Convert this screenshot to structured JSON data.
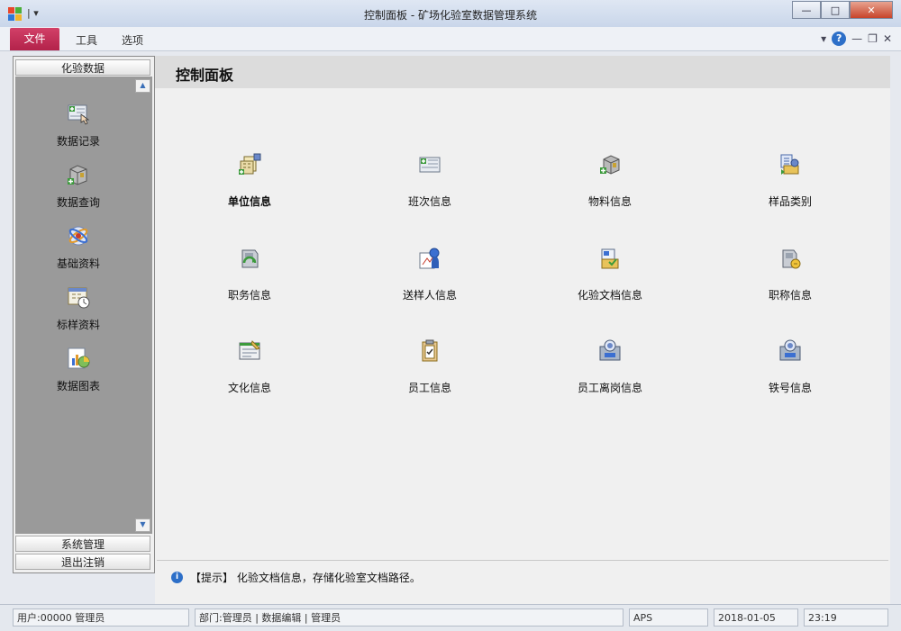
{
  "window": {
    "title": "控制面板 - 矿场化验室数据管理系统",
    "qat": "|  ▾",
    "min": "—",
    "max": "□",
    "close": "✕"
  },
  "ribbon": {
    "file": "文件",
    "tabs": [
      "工具",
      "选项"
    ],
    "help": "?",
    "chevron": "▾",
    "min": "—",
    "restore": "❐",
    "close": "✕"
  },
  "sidebar": {
    "group_top": "化验数据",
    "items": [
      {
        "label": "数据记录",
        "icon": "data-record-icon"
      },
      {
        "label": "数据查询",
        "icon": "data-query-icon"
      },
      {
        "label": "基础资料",
        "icon": "basic-info-icon"
      },
      {
        "label": "标样资料",
        "icon": "standard-sample-icon"
      },
      {
        "label": "数据图表",
        "icon": "data-chart-icon"
      }
    ],
    "group_system": "系统管理",
    "group_logout": "退出注销"
  },
  "main": {
    "title": "控制面板",
    "items": [
      {
        "label": "单位信息",
        "icon": "unit-info-icon"
      },
      {
        "label": "班次信息",
        "icon": "shift-info-icon"
      },
      {
        "label": "物料信息",
        "icon": "material-info-icon"
      },
      {
        "label": "样品类别",
        "icon": "sample-category-icon"
      },
      {
        "label": "职务信息",
        "icon": "duty-info-icon"
      },
      {
        "label": "送样人信息",
        "icon": "sampler-info-icon"
      },
      {
        "label": "化验文档信息",
        "icon": "lab-document-icon"
      },
      {
        "label": "职称信息",
        "icon": "title-info-icon"
      },
      {
        "label": "文化信息",
        "icon": "education-info-icon"
      },
      {
        "label": "员工信息",
        "icon": "employee-info-icon"
      },
      {
        "label": "员工离岗信息",
        "icon": "employee-leave-icon"
      },
      {
        "label": "铁号信息",
        "icon": "iron-number-icon"
      }
    ],
    "hint": "【提示】 化验文档信息，存储化验室文档路径。"
  },
  "statusbar": {
    "cells": [
      "用户:00000 管理员",
      "部门:管理员 | 数据编辑 | 管理员",
      "APS",
      "2018-01-05",
      "23:19"
    ]
  },
  "colors": {
    "file_tab": "#c32c55",
    "sidebar_body": "#9a9a9a",
    "panel_header": "#dcdcdc"
  }
}
